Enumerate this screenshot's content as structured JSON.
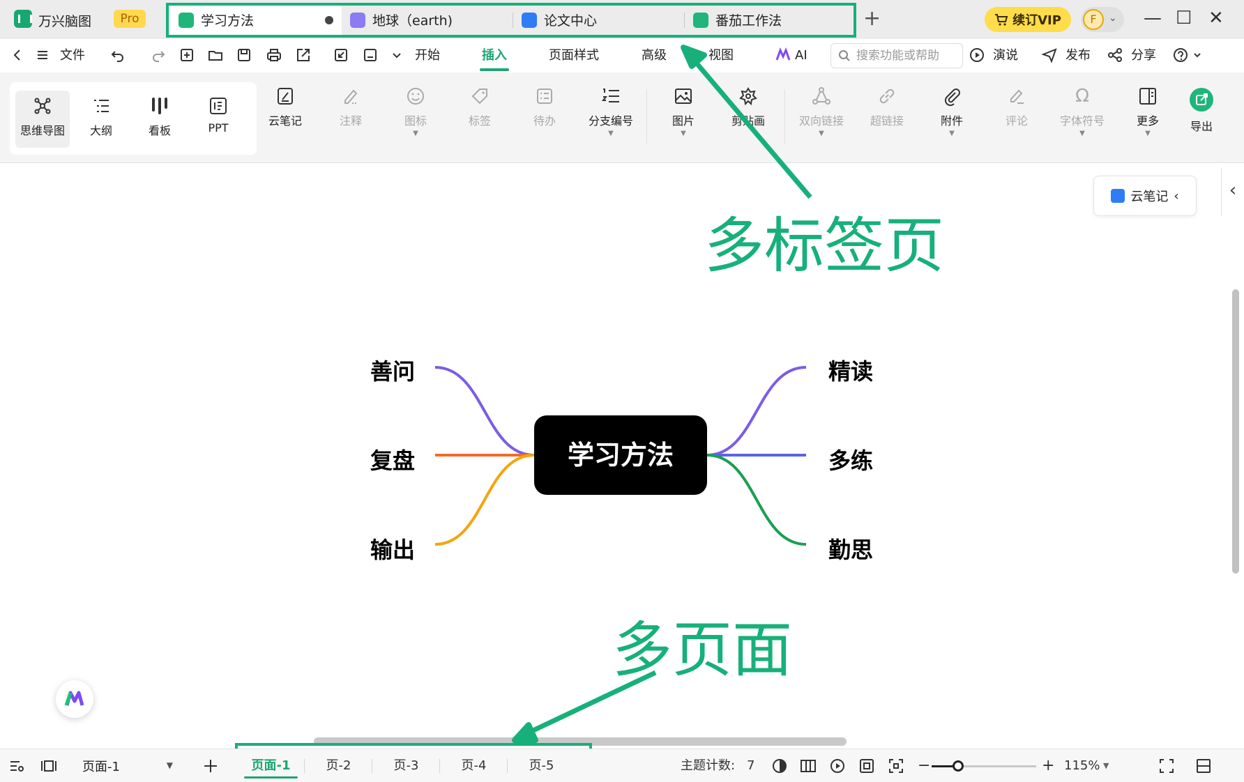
{
  "app": {
    "name": "万兴脑图",
    "badge": "Pro"
  },
  "tabs": [
    {
      "label": "学习方法",
      "icon": "mindmap-doc-icon",
      "color": "#1fb57b",
      "active": true,
      "modified": true
    },
    {
      "label": "地球（earth)",
      "icon": "earth-doc-icon",
      "color": "#7b6cf0",
      "active": false
    },
    {
      "label": "论文中心",
      "icon": "team-doc-icon",
      "color": "#2e7cf6",
      "active": false
    },
    {
      "label": "番茄工作法",
      "icon": "cloud-doc-icon",
      "color": "#1fb57b",
      "active": false
    }
  ],
  "titlebar": {
    "vip_label": "续订VIP",
    "avatar_letter": "F"
  },
  "menubar": {
    "file_label": "文件",
    "tabs": [
      "开始",
      "插入",
      "页面样式",
      "高级",
      "视图"
    ],
    "active_tab": "插入",
    "ai_label": "AI",
    "search_placeholder": "搜索功能或帮助",
    "present_label": "演说",
    "publish_label": "发布",
    "share_label": "分享"
  },
  "ribbon": {
    "views": [
      {
        "label": "思维导图",
        "icon": "mindmap-view-icon",
        "active": true
      },
      {
        "label": "大纲",
        "icon": "outline-view-icon"
      },
      {
        "label": "看板",
        "icon": "kanban-view-icon"
      },
      {
        "label": "PPT",
        "icon": "ppt-view-icon"
      }
    ],
    "tools": [
      {
        "label": "云笔记",
        "icon": "cloud-note-icon",
        "enabled": true
      },
      {
        "label": "注释",
        "icon": "annotation-icon",
        "enabled": false
      },
      {
        "label": "图标",
        "icon": "emoji-icon",
        "enabled": false,
        "dropdown": true
      },
      {
        "label": "标签",
        "icon": "tag-icon",
        "enabled": false
      },
      {
        "label": "待办",
        "icon": "todo-icon",
        "enabled": false
      },
      {
        "label": "分支编号",
        "icon": "numbering-icon",
        "enabled": true,
        "dropdown": true
      },
      {
        "label": "图片",
        "icon": "image-icon",
        "enabled": true,
        "dropdown": true
      },
      {
        "label": "剪贴画",
        "icon": "clipart-icon",
        "enabled": true
      },
      {
        "label": "双向链接",
        "icon": "bilink-icon",
        "enabled": false,
        "dropdown": true
      },
      {
        "label": "超链接",
        "icon": "hyperlink-icon",
        "enabled": false
      },
      {
        "label": "附件",
        "icon": "attachment-icon",
        "enabled": true,
        "dropdown": true
      },
      {
        "label": "评论",
        "icon": "comment-icon",
        "enabled": false
      },
      {
        "label": "字体符号",
        "icon": "omega-icon",
        "enabled": false,
        "dropdown": true
      },
      {
        "label": "更多",
        "icon": "more-icon",
        "enabled": true,
        "dropdown": true
      },
      {
        "label": "导出",
        "icon": "export-icon",
        "enabled": true
      }
    ]
  },
  "side_panel": {
    "cloud_note_label": "云笔记"
  },
  "mindmap": {
    "central": "学习方法",
    "left": [
      {
        "label": "善问",
        "color": "#7b5ce6"
      },
      {
        "label": "复盘",
        "color": "#f26b2a"
      },
      {
        "label": "输出",
        "color": "#f5a40f"
      }
    ],
    "right": [
      {
        "label": "精读",
        "color": "#7b5ce6"
      },
      {
        "label": "多练",
        "color": "#5b62e8"
      },
      {
        "label": "勤思",
        "color": "#1a9e52"
      }
    ]
  },
  "annotations": {
    "tabs_callout": "多标签页",
    "pages_callout": "多页面",
    "color": "#17b07a"
  },
  "statusbar": {
    "page_selector": "页面-1",
    "pages": [
      "页面-1",
      "页-2",
      "页-3",
      "页-4",
      "页-5"
    ],
    "active_page": "页面-1",
    "topic_count_label": "主题计数:",
    "topic_count": "7",
    "zoom": "115%",
    "zoom_level": 0.25
  }
}
